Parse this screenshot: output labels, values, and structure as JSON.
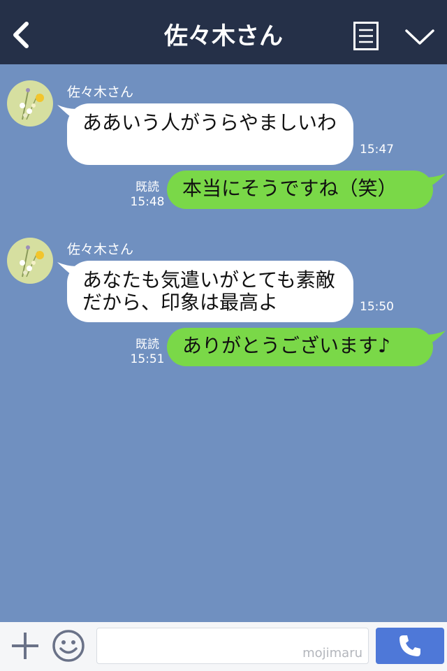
{
  "header": {
    "title": "佐々木さん"
  },
  "messages": [
    {
      "sender": "佐々木さん",
      "text": "ああいう人がうらやましいわ",
      "time": "15:47"
    },
    {
      "read": "既読",
      "time": "15:48",
      "text": "本当にそうですね（笑）"
    },
    {
      "sender": "佐々木さん",
      "text": "あなたも気遣いがとても素敵だから、印象は最高よ",
      "time": "15:50"
    },
    {
      "read": "既読",
      "time": "15:51",
      "text": "ありがとうございます♪"
    }
  ],
  "footer": {
    "watermark": "mojimaru"
  },
  "colors": {
    "header_bg": "#253048",
    "chat_bg": "#7090c0",
    "outgoing_bubble": "#7ad848",
    "incoming_bubble": "#ffffff",
    "call_button": "#4e78d8"
  },
  "icons": {
    "back": "chevron-left-icon",
    "menu": "list-icon",
    "collapse": "chevron-down-icon",
    "add": "plus-icon",
    "emoji": "smiley-icon",
    "call": "phone-icon"
  }
}
